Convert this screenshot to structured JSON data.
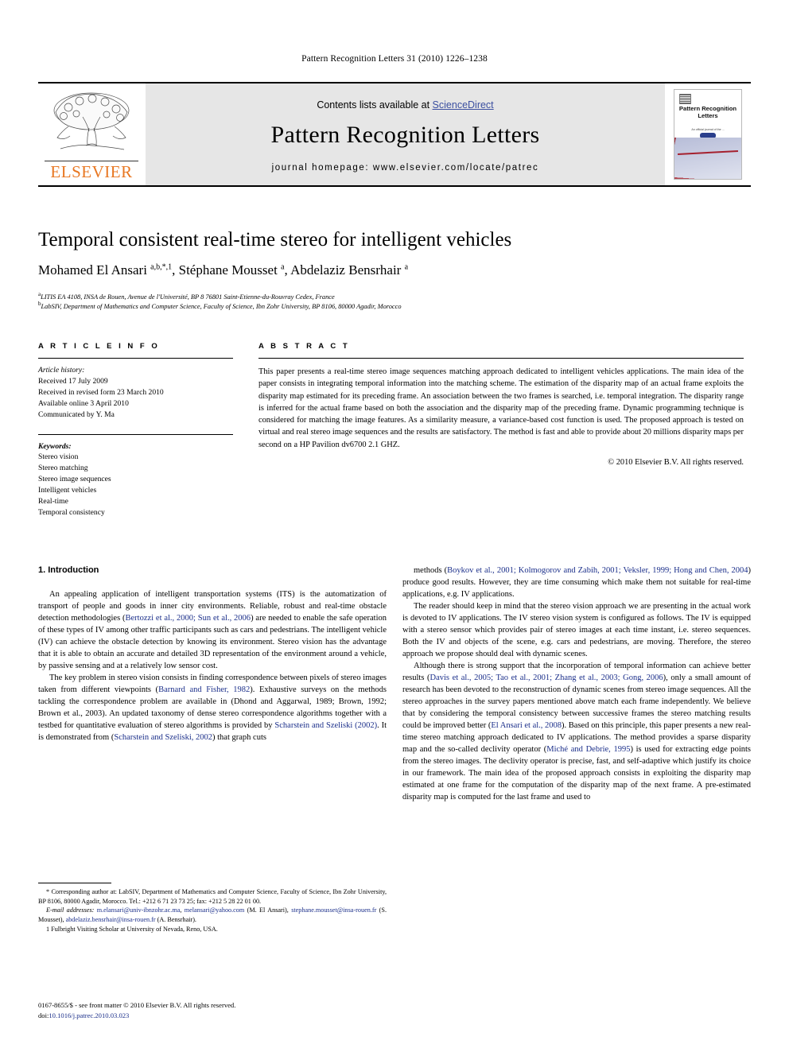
{
  "running_head": "Pattern Recognition Letters 31 (2010) 1226–1238",
  "masthead": {
    "contents_prefix": "Contents lists available at ",
    "sciencedirect": "ScienceDirect",
    "journal_name": "Pattern Recognition Letters",
    "homepage": "journal homepage: www.elsevier.com/locate/patrec",
    "publisher": "ELSEVIER",
    "cover_title": "Pattern Recognition Letters",
    "cover_subtitle": "An official journal of the ...",
    "sciencedirect_color": "#3b4fa0",
    "elsevier_orange": "#E87722"
  },
  "article": {
    "title": "Temporal consistent real-time stereo for intelligent vehicles",
    "authors_html": "Mohamed El Ansari <sup>a,b,*,1</sup>, Stéphane Mousset <sup>a</sup>, Abdelaziz Bensrhair <sup>a</sup>",
    "affiliation_a": "LITIS EA 4108, INSA de Rouen, Avenue de l'Université, BP 8 76801 Saint-Etienne-du-Rouvray Cedex, France",
    "affiliation_b": "LabSIV, Department of Mathematics and Computer Science, Faculty of Science, Ibn Zohr University, BP 8106, 80000 Agadir, Morocco"
  },
  "info": {
    "heading": "A R T I C L E   I N F O",
    "history_label": "Article history:",
    "history": [
      "Received 17 July 2009",
      "Received in revised form 23 March 2010",
      "Available online 3 April 2010",
      "Communicated by Y. Ma"
    ],
    "keywords_label": "Keywords:",
    "keywords": [
      "Stereo vision",
      "Stereo matching",
      "Stereo image sequences",
      "Intelligent vehicles",
      "Real-time",
      "Temporal consistency"
    ]
  },
  "abstract": {
    "heading": "A B S T R A C T",
    "text": "This paper presents a real-time stereo image sequences matching approach dedicated to intelligent vehicles applications. The main idea of the paper consists in integrating temporal information into the matching scheme. The estimation of the disparity map of an actual frame exploits the disparity map estimated for its preceding frame. An association between the two frames is searched, i.e. temporal integration. The disparity range is inferred for the actual frame based on both the association and the disparity map of the preceding frame. Dynamic programming technique is considered for matching the image features. As a similarity measure, a variance-based cost function is used. The proposed approach is tested on virtual and real stereo image sequences and the results are satisfactory. The method is fast and able to provide about 20 millions disparity maps per second on a HP Pavilion dv6700 2.1 GHZ.",
    "copyright": "© 2010 Elsevier B.V. All rights reserved."
  },
  "body": {
    "section_heading": "1. Introduction",
    "left_paragraphs": [
      "An appealing application of intelligent transportation systems (ITS) is the automatization of transport of people and goods in inner city environments. Reliable, robust and real-time obstacle detection methodologies (<span class=\"cite\">Bertozzi et al., 2000; Sun et al., 2006</span>) are needed to enable the safe operation of these types of IV among other traffic participants such as cars and pedestrians. The intelligent vehicle (IV) can achieve the obstacle detection by knowing its environment. Stereo vision has the advantage that it is able to obtain an accurate and detailed 3D representation of the environment around a vehicle, by passive sensing and at a relatively low sensor cost.",
      "The key problem in stereo vision consists in finding correspondence between pixels of stereo images taken from different viewpoints (<span class=\"cite\">Barnard and Fisher, 1982</span>). Exhaustive surveys on the methods tackling the correspondence problem are available in (Dhond and Aggarwal, 1989; Brown, 1992; Brown et al., 2003). An updated taxonomy of dense stereo correspondence algorithms together with a testbed for quantitative evaluation of stereo algorithms is provided by <span class=\"cite\">Scharstein and Szeliski (2002)</span>. It is demonstrated from (<span class=\"cite\">Scharstein and Szeliski, 2002</span>) that graph cuts"
    ],
    "right_paragraphs": [
      "methods (<span class=\"cite\">Boykov et al., 2001; Kolmogorov and Zabih, 2001; Veksler, 1999; Hong and Chen, 2004</span>) produce good results. However, they are time consuming which make them not suitable for real-time applications, e.g. IV applications.",
      "The reader should keep in mind that the stereo vision approach we are presenting in the actual work is devoted to IV applications. The IV stereo vision system is configured as follows. The IV is equipped with a stereo sensor which provides pair of stereo images at each time instant, i.e. stereo sequences. Both the IV and objects of the scene, e.g. cars and pedestrians, are moving. Therefore, the stereo approach we propose should deal with dynamic scenes.",
      "Although there is strong support that the incorporation of temporal information can achieve better results (<span class=\"cite\">Davis et al., 2005; Tao et al., 2001; Zhang et al., 2003; Gong, 2006</span>), only a small amount of research has been devoted to the reconstruction of dynamic scenes from stereo image sequences. All the stereo approaches in the survey papers mentioned above match each frame independently. We believe that by considering the temporal consistency between successive frames the stereo matching results could be improved better (<span class=\"cite\">El Ansari et al., 2008</span>). Based on this principle, this paper presents a new real-time stereo matching approach dedicated to IV applications. The method provides a sparse disparity map and the so-called declivity operator (<span class=\"cite\">Miché and Debrie, 1995</span>) is used for extracting edge points from the stereo images. The declivity operator is precise, fast, and self-adaptive which justify its choice in our framework. The main idea of the proposed approach consists in exploiting the disparity map estimated at one frame for the computation of the disparity map of the next frame. A pre-estimated disparity map is computed for the last frame and used to"
    ]
  },
  "footnotes": {
    "corresponding": "* Corresponding author at: LabSIV, Department of Mathematics and Computer Science, Faculty of Science, Ibn Zohr University, BP 8106, 80000 Agadir, Morocco. Tel.: +212 6 71 23 73 25; fax: +212 5 28 22 01 00.",
    "emails_html": "<span class=\"em-italic\">E-mail addresses:</span> <span class=\"cite\">m.elansari@univ-ibnzohr.ac.ma</span>, <span class=\"cite\">melansari@yahoo.com</span> (M. El Ansari), <span class=\"cite\">stephane.mousset@insa-rouen.fr</span> (S. Mousset), <span class=\"cite\">abdelaziz.bensrhair@insa-rouen.fr</span> (A. Bensrhair).",
    "note1": "1 Fulbright Visiting Scholar at University of Nevada, Reno, USA."
  },
  "imprint": {
    "issn_line": "0167-8655/$ - see front matter © 2010 Elsevier B.V. All rights reserved.",
    "doi_label": "doi:",
    "doi_value": "10.1016/j.patrec.2010.03.023"
  }
}
